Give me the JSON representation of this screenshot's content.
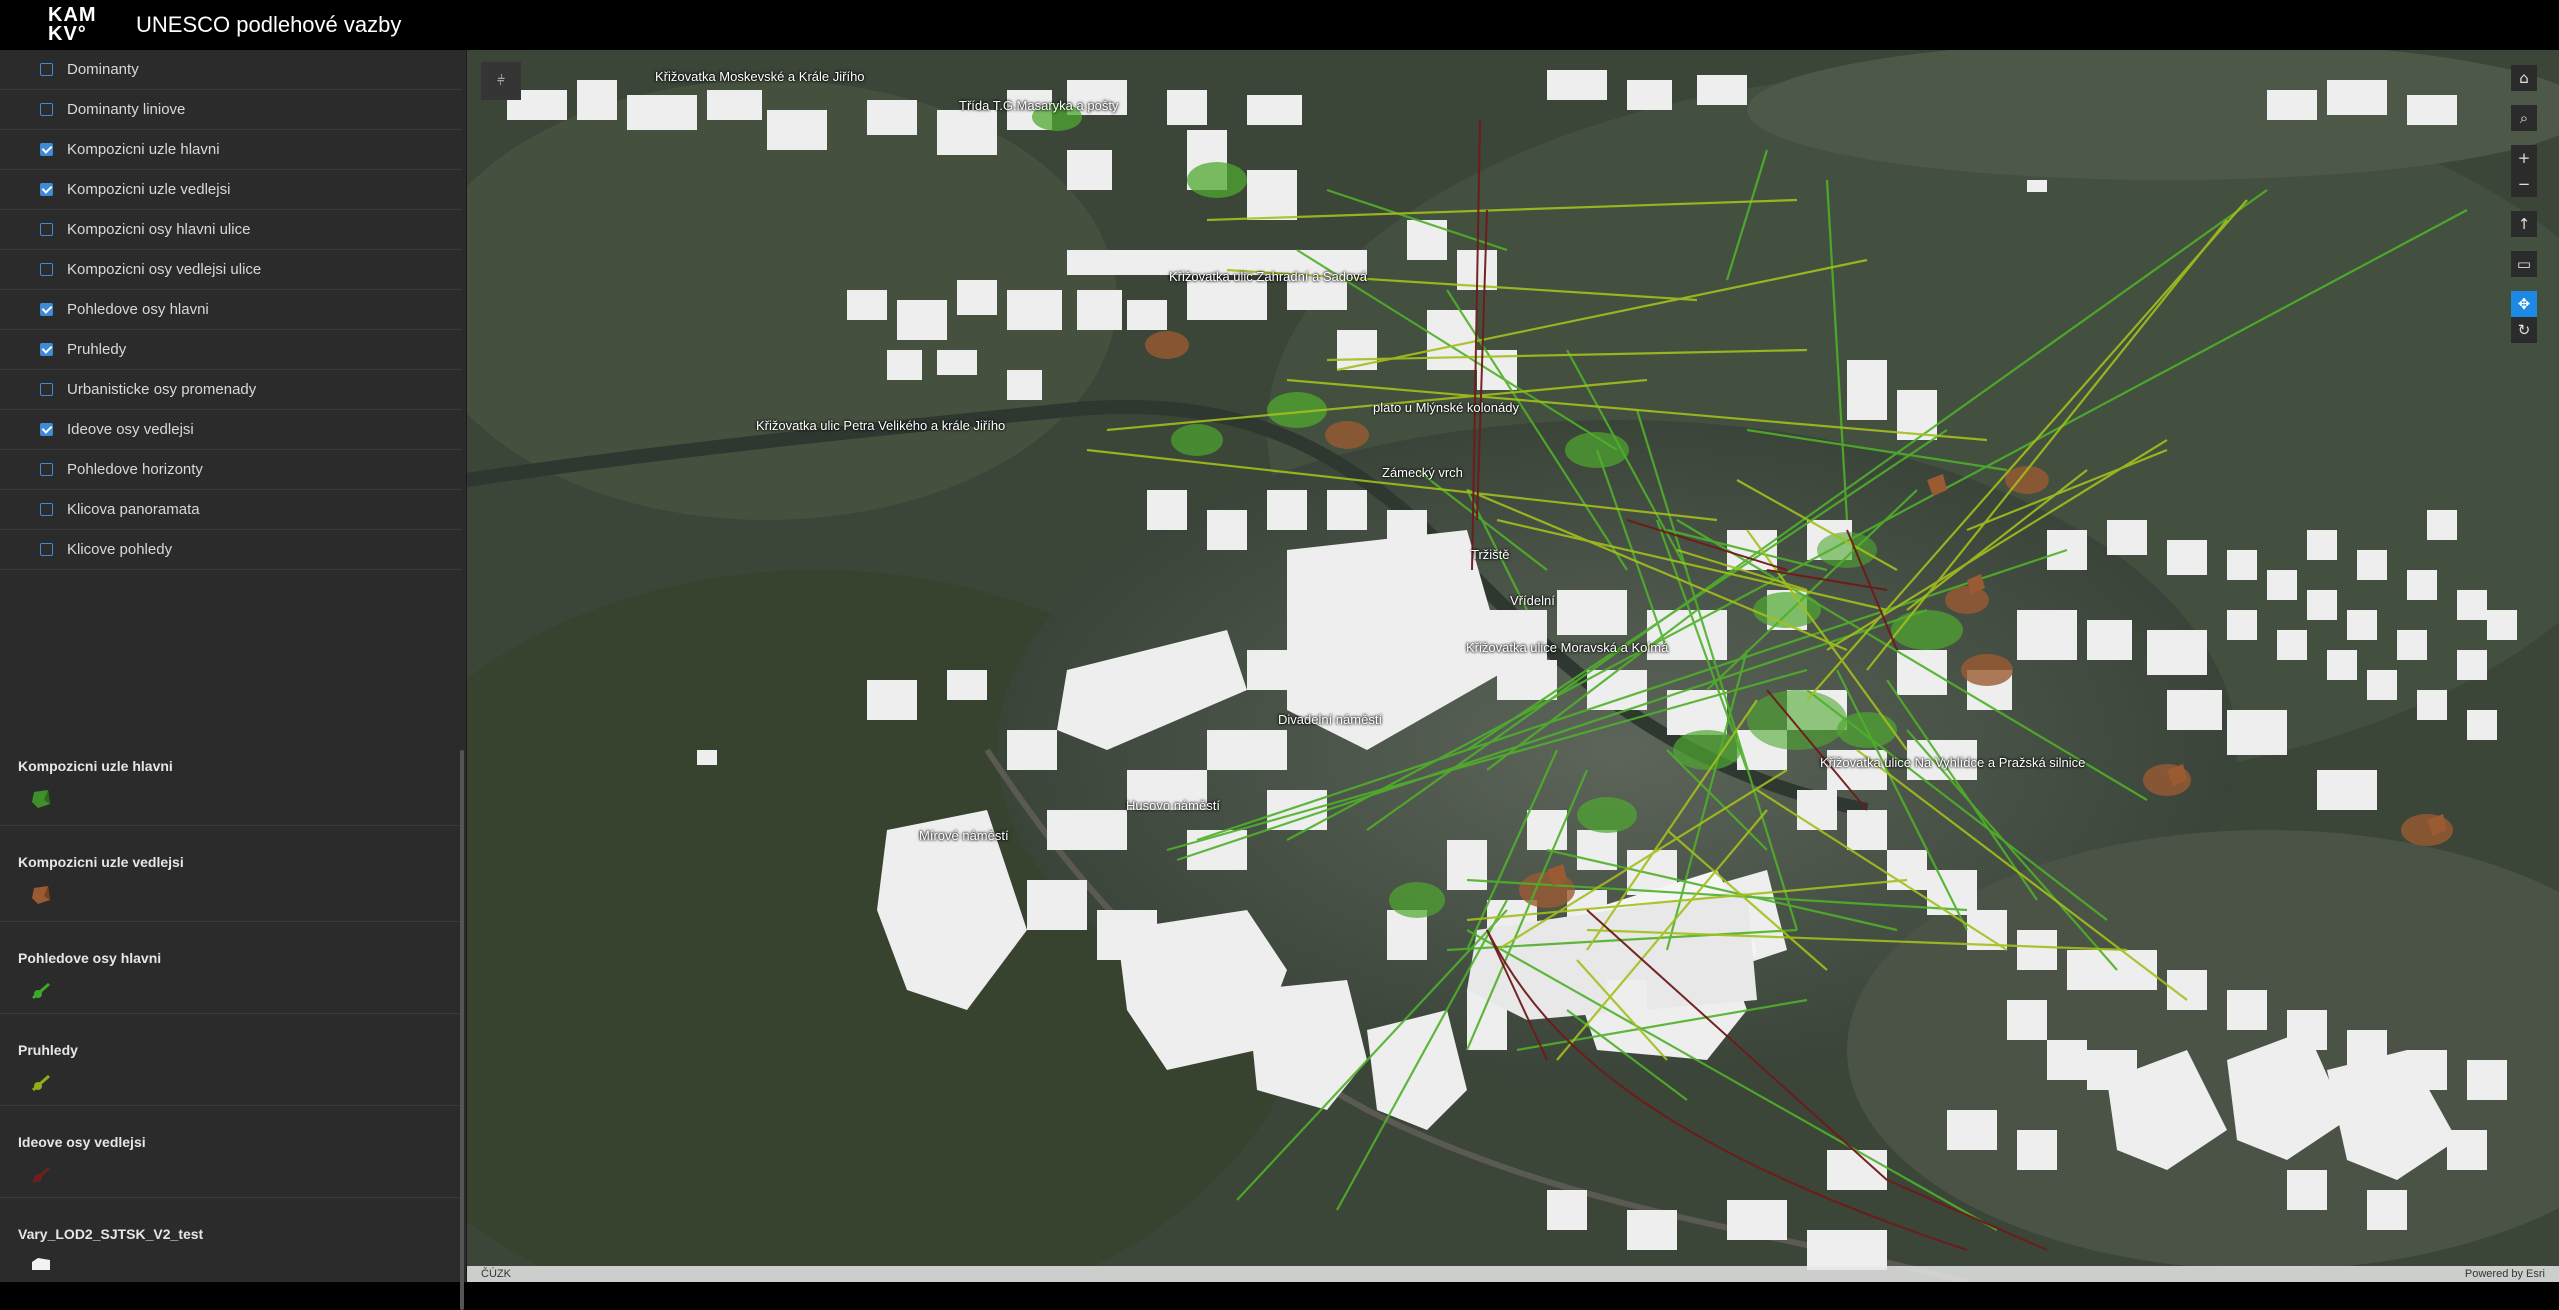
{
  "header": {
    "logo_line1": "KAM",
    "logo_line2": "KV°",
    "title": "UNESCO podlehové vazby"
  },
  "layers": [
    {
      "label": "Dominanty",
      "checked": false
    },
    {
      "label": "Dominanty liniove",
      "checked": false
    },
    {
      "label": "Kompozicni uzle hlavni",
      "checked": true
    },
    {
      "label": "Kompozicni uzle vedlejsi",
      "checked": true
    },
    {
      "label": "Kompozicni osy hlavni ulice",
      "checked": false
    },
    {
      "label": "Kompozicni osy vedlejsi ulice",
      "checked": false
    },
    {
      "label": "Pohledove osy hlavni",
      "checked": true
    },
    {
      "label": "Pruhledy",
      "checked": true
    },
    {
      "label": "Urbanisticke osy promenady",
      "checked": false
    },
    {
      "label": "Ideove osy vedlejsi",
      "checked": true
    },
    {
      "label": "Pohledove horizonty",
      "checked": false
    },
    {
      "label": "Klicova panoramata",
      "checked": false
    },
    {
      "label": "Klicove pohledy",
      "checked": false
    }
  ],
  "legend": [
    {
      "title": "Kompozicni uzle hlavni",
      "symbol": "polygon",
      "color": "#3f8f2a"
    },
    {
      "title": "Kompozicni uzle vedlejsi",
      "symbol": "polygon",
      "color": "#9a5a32"
    },
    {
      "title": "Pohledove osy hlavni",
      "symbol": "line",
      "color": "#3fa82a"
    },
    {
      "title": "Pruhledy",
      "symbol": "line",
      "color": "#8fae1a"
    },
    {
      "title": "Ideove osy vedlejsi",
      "symbol": "line",
      "color": "#6e1f1f"
    },
    {
      "title": "Vary_LOD2_SJTSK_V2_test",
      "symbol": "building",
      "color": "#f2f2f2"
    }
  ],
  "map": {
    "labels": [
      "Křižovatka Moskevské a Krále Jiřího",
      "Třída T.G.Masaryka a pošty",
      "Křižovatka ulic Zahradní a Sadová",
      "plato u Mlýnské kolonády",
      "Křižovatka ulic Petra Velikého a krále Jiřího",
      "Zámecký vrch",
      "Tržiště",
      "Vřídelní",
      "Křižovatka ulice Moravská a Kolmá",
      "Divadelní náměstí",
      "Křižovatka ulice Na Vyhlídce a Pražská silnice",
      "Husovo náměstí",
      "Mírové náměstí"
    ],
    "attribution_left": "ČÚZK",
    "attribution_right": "Powered by Esri",
    "toolbar_icons": [
      "home-icon",
      "search-icon",
      "zoom-in-icon",
      "zoom-out-icon",
      "compass-icon",
      "measure-icon",
      "pan-icon",
      "rotate-icon"
    ]
  },
  "colors": {
    "main_axis": "#4fb02a",
    "pruhled": "#9fbf1e",
    "ideove": "#6e1a1a",
    "accent": "#1e88e5"
  }
}
